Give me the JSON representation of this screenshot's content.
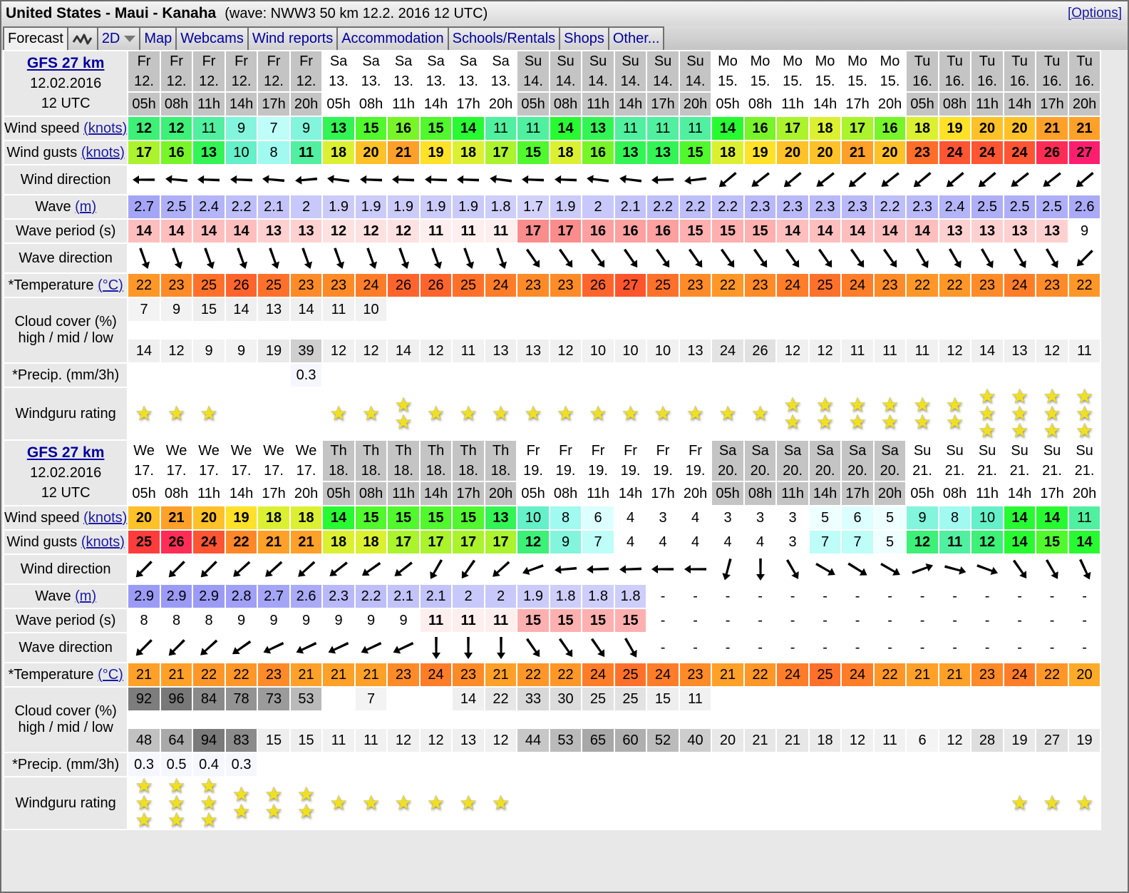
{
  "title": {
    "spot": "United States - Maui - Kanaha",
    "wave_info": "(wave: NWW3 50 km 12.2. 2016 12 UTC)",
    "options_link": "[Options]"
  },
  "tabs": [
    {
      "label": "Forecast",
      "active": true
    },
    {
      "label": "",
      "icon": "waveform-icon"
    },
    {
      "label": "2D",
      "icon": "dropdown-triangle-icon"
    },
    {
      "label": "Map"
    },
    {
      "label": "Webcams"
    },
    {
      "label": "Wind reports"
    },
    {
      "label": "Accommodation"
    },
    {
      "label": "Schools/Rentals"
    },
    {
      "label": "Shops"
    },
    {
      "label": "Other..."
    }
  ],
  "labels": {
    "wind_speed": "Wind speed ",
    "wind_gusts": "Wind gusts ",
    "knots": "(knots)",
    "wind_direction": "Wind direction",
    "wave": "Wave ",
    "wave_unit": "(m)",
    "wave_period": "Wave period (s)",
    "wave_direction": "Wave direction",
    "temperature": "*Temperature ",
    "temp_unit": "(°C)",
    "cloud_cover_1": "Cloud cover (%)",
    "cloud_cover_2": "high / mid / low",
    "precip": "*Precip. (mm/3h)",
    "rating": "Windguru rating"
  },
  "colors": {
    "link": "#1a1aa6",
    "label_bg": "#e8e8e8",
    "day_light": "#ececec",
    "day_dark": "#c4c4c4",
    "star": "#f0e020"
  },
  "blocks": [
    {
      "model": "GFS 27 km",
      "date": "12.02.2016",
      "utc": "12 UTC",
      "days": [
        "Fr",
        "Fr",
        "Fr",
        "Fr",
        "Fr",
        "Fr",
        "Sa",
        "Sa",
        "Sa",
        "Sa",
        "Sa",
        "Sa",
        "Su",
        "Su",
        "Su",
        "Su",
        "Su",
        "Su",
        "Mo",
        "Mo",
        "Mo",
        "Mo",
        "Mo",
        "Mo",
        "Tu",
        "Tu",
        "Tu",
        "Tu",
        "Tu",
        "Tu"
      ],
      "dates": [
        "12.",
        "12.",
        "12.",
        "12.",
        "12.",
        "12.",
        "13.",
        "13.",
        "13.",
        "13.",
        "13.",
        "13.",
        "14.",
        "14.",
        "14.",
        "14.",
        "14.",
        "14.",
        "15.",
        "15.",
        "15.",
        "15.",
        "15.",
        "15.",
        "16.",
        "16.",
        "16.",
        "16.",
        "16.",
        "16."
      ],
      "hours": [
        "05h",
        "08h",
        "11h",
        "14h",
        "17h",
        "20h",
        "05h",
        "08h",
        "11h",
        "14h",
        "17h",
        "20h",
        "05h",
        "08h",
        "11h",
        "14h",
        "17h",
        "20h",
        "05h",
        "08h",
        "11h",
        "14h",
        "17h",
        "20h",
        "05h",
        "08h",
        "11h",
        "14h",
        "17h",
        "20h"
      ],
      "dark_day": [
        true,
        true,
        true,
        true,
        true,
        true,
        false,
        false,
        false,
        false,
        false,
        false,
        true,
        true,
        true,
        true,
        true,
        true,
        false,
        false,
        false,
        false,
        false,
        false,
        true,
        true,
        true,
        true,
        true,
        true
      ],
      "wind_speed": [
        12,
        12,
        11,
        9,
        7,
        9,
        13,
        15,
        16,
        15,
        14,
        11,
        11,
        14,
        13,
        11,
        11,
        11,
        14,
        16,
        17,
        18,
        17,
        16,
        18,
        19,
        20,
        20,
        21,
        21
      ],
      "wind_gusts": [
        17,
        16,
        13,
        10,
        8,
        11,
        18,
        20,
        21,
        19,
        18,
        17,
        15,
        18,
        16,
        13,
        13,
        15,
        18,
        19,
        20,
        20,
        21,
        20,
        23,
        24,
        24,
        24,
        26,
        27
      ],
      "wind_dir_to": [
        270,
        275,
        272,
        272,
        275,
        265,
        277,
        272,
        272,
        272,
        272,
        277,
        272,
        272,
        277,
        277,
        268,
        263,
        230,
        232,
        230,
        232,
        230,
        232,
        230,
        230,
        230,
        232,
        232,
        230
      ],
      "wave": [
        "2.7",
        "2.5",
        "2.4",
        "2.2",
        "2.1",
        "2",
        "1.9",
        "1.9",
        "1.9",
        "1.9",
        "1.9",
        "1.8",
        "1.7",
        "1.9",
        "2",
        "2.1",
        "2.2",
        "2.2",
        "2.2",
        "2.3",
        "2.3",
        "2.3",
        "2.3",
        "2.2",
        "2.3",
        "2.4",
        "2.5",
        "2.5",
        "2.5",
        "2.6"
      ],
      "wave_period": [
        "14",
        "14",
        "14",
        "14",
        "13",
        "13",
        "12",
        "12",
        "12",
        "11",
        "11",
        "11",
        "17",
        "17",
        "16",
        "16",
        "16",
        "15",
        "15",
        "15",
        "14",
        "14",
        "14",
        "14",
        "14",
        "13",
        "13",
        "13",
        "13",
        "9"
      ],
      "wave_dir_to": [
        160,
        160,
        160,
        160,
        160,
        160,
        160,
        160,
        160,
        160,
        160,
        160,
        145,
        145,
        145,
        145,
        145,
        145,
        145,
        145,
        145,
        145,
        145,
        145,
        150,
        150,
        150,
        150,
        150,
        225
      ],
      "temperature": [
        22,
        23,
        25,
        26,
        25,
        23,
        23,
        24,
        26,
        26,
        25,
        24,
        23,
        23,
        26,
        27,
        25,
        23,
        22,
        23,
        24,
        25,
        24,
        23,
        22,
        22,
        23,
        24,
        23,
        22
      ],
      "cloud_high": [
        "7",
        "9",
        "15",
        "14",
        "13",
        "14",
        "11",
        "10",
        "",
        "",
        "",
        "",
        "",
        "",
        "",
        "",
        "",
        "",
        "",
        "",
        "",
        "",
        "",
        "",
        "",
        "",
        "",
        "",
        "",
        ""
      ],
      "cloud_mid": [
        "",
        "",
        "",
        "",
        "",
        "",
        "",
        "",
        "",
        "",
        "",
        "",
        "",
        "",
        "",
        "",
        "",
        "",
        "",
        "",
        "",
        "",
        "",
        "",
        "",
        "",
        "",
        "",
        "",
        ""
      ],
      "cloud_low": [
        "14",
        "12",
        "9",
        "9",
        "19",
        "39",
        "12",
        "12",
        "14",
        "12",
        "11",
        "13",
        "13",
        "12",
        "10",
        "10",
        "10",
        "13",
        "24",
        "26",
        "12",
        "12",
        "11",
        "11",
        "11",
        "12",
        "14",
        "13",
        "12",
        "11"
      ],
      "precip": [
        "",
        "",
        "",
        "",
        "",
        "0.3",
        "",
        "",
        "",
        "",
        "",
        "",
        "",
        "",
        "",
        "",
        "",
        "",
        "",
        "",
        "",
        "",
        "",
        "",
        "",
        "",
        "",
        "",
        "",
        ""
      ],
      "rating": [
        1,
        1,
        1,
        0,
        0,
        0,
        1,
        1,
        2,
        1,
        1,
        1,
        1,
        1,
        1,
        1,
        1,
        1,
        1,
        1,
        2,
        2,
        2,
        2,
        2,
        2,
        3,
        3,
        3,
        3
      ]
    },
    {
      "model": "GFS 27 km",
      "date": "12.02.2016",
      "utc": "12 UTC",
      "days": [
        "We",
        "We",
        "We",
        "We",
        "We",
        "We",
        "Th",
        "Th",
        "Th",
        "Th",
        "Th",
        "Th",
        "Fr",
        "Fr",
        "Fr",
        "Fr",
        "Fr",
        "Fr",
        "Sa",
        "Sa",
        "Sa",
        "Sa",
        "Sa",
        "Sa",
        "Su",
        "Su",
        "Su",
        "Su",
        "Su",
        "Su"
      ],
      "dates": [
        "17.",
        "17.",
        "17.",
        "17.",
        "17.",
        "17.",
        "18.",
        "18.",
        "18.",
        "18.",
        "18.",
        "18.",
        "19.",
        "19.",
        "19.",
        "19.",
        "19.",
        "19.",
        "20.",
        "20.",
        "20.",
        "20.",
        "20.",
        "20.",
        "21.",
        "21.",
        "21.",
        "21.",
        "21.",
        "21."
      ],
      "hours": [
        "05h",
        "08h",
        "11h",
        "14h",
        "17h",
        "20h",
        "05h",
        "08h",
        "11h",
        "14h",
        "17h",
        "20h",
        "05h",
        "08h",
        "11h",
        "14h",
        "17h",
        "20h",
        "05h",
        "08h",
        "11h",
        "14h",
        "17h",
        "20h",
        "05h",
        "08h",
        "11h",
        "14h",
        "17h",
        "20h"
      ],
      "dark_day": [
        false,
        false,
        false,
        false,
        false,
        false,
        true,
        true,
        true,
        true,
        true,
        true,
        false,
        false,
        false,
        false,
        false,
        false,
        true,
        true,
        true,
        true,
        true,
        true,
        false,
        false,
        false,
        false,
        false,
        false
      ],
      "wind_speed": [
        20,
        21,
        20,
        19,
        18,
        18,
        14,
        15,
        15,
        15,
        15,
        13,
        10,
        8,
        6,
        4,
        3,
        4,
        3,
        3,
        3,
        5,
        6,
        5,
        9,
        8,
        10,
        14,
        14,
        11
      ],
      "wind_gusts": [
        25,
        26,
        24,
        22,
        21,
        21,
        18,
        18,
        17,
        17,
        17,
        17,
        12,
        9,
        7,
        4,
        4,
        4,
        4,
        4,
        3,
        7,
        7,
        5,
        12,
        11,
        12,
        14,
        15,
        14
      ],
      "wind_dir_to": [
        225,
        225,
        225,
        228,
        228,
        228,
        232,
        235,
        232,
        210,
        215,
        228,
        250,
        265,
        268,
        268,
        270,
        270,
        195,
        180,
        150,
        120,
        122,
        120,
        70,
        105,
        110,
        145,
        150,
        155
      ],
      "wave": [
        "2.9",
        "2.9",
        "2.9",
        "2.8",
        "2.7",
        "2.6",
        "2.3",
        "2.2",
        "2.1",
        "2.1",
        "2",
        "2",
        "1.9",
        "1.8",
        "1.8",
        "1.8",
        "-",
        "-",
        "-",
        "-",
        "-",
        "-",
        "-",
        "-",
        "-",
        "-",
        "-",
        "-",
        "-",
        "-"
      ],
      "wave_period": [
        "8",
        "8",
        "8",
        "9",
        "9",
        "9",
        "9",
        "9",
        "9",
        "11",
        "11",
        "11",
        "15",
        "15",
        "15",
        "15",
        "-",
        "-",
        "-",
        "-",
        "-",
        "-",
        "-",
        "-",
        "-",
        "-",
        "-",
        "-",
        "-",
        "-"
      ],
      "wave_dir_to": [
        225,
        225,
        228,
        235,
        245,
        245,
        245,
        245,
        245,
        180,
        180,
        180,
        145,
        145,
        145,
        150,
        null,
        null,
        null,
        null,
        null,
        null,
        null,
        null,
        null,
        null,
        null,
        null,
        null,
        null
      ],
      "temperature": [
        21,
        21,
        22,
        22,
        23,
        21,
        21,
        21,
        23,
        24,
        23,
        21,
        22,
        22,
        24,
        25,
        24,
        23,
        21,
        22,
        24,
        25,
        24,
        22,
        21,
        21,
        23,
        24,
        22,
        20
      ],
      "cloud_high": [
        "92",
        "96",
        "84",
        "78",
        "73",
        "53",
        "",
        "7",
        "",
        "",
        "14",
        "22",
        "33",
        "30",
        "25",
        "25",
        "15",
        "11",
        "",
        "",
        "",
        "",
        "",
        "",
        "",
        "",
        "",
        "",
        "",
        ""
      ],
      "cloud_mid": [
        "",
        "",
        "",
        "",
        "",
        "",
        "",
        "",
        "",
        "",
        "",
        "",
        "",
        "",
        "",
        "",
        "",
        "",
        "",
        "",
        "",
        "",
        "",
        "",
        "",
        "",
        "",
        "",
        "",
        ""
      ],
      "cloud_low": [
        "48",
        "64",
        "94",
        "83",
        "15",
        "15",
        "11",
        "11",
        "12",
        "12",
        "13",
        "12",
        "44",
        "53",
        "65",
        "60",
        "52",
        "40",
        "20",
        "21",
        "21",
        "18",
        "12",
        "11",
        "6",
        "12",
        "28",
        "19",
        "27",
        "19"
      ],
      "precip": [
        "0.3",
        "0.5",
        "0.4",
        "0.3",
        "",
        "",
        "",
        "",
        "",
        "",
        "",
        "",
        "",
        "",
        "",
        "",
        "",
        "",
        "",
        "",
        "",
        "",
        "",
        "",
        "",
        "",
        "",
        "",
        "",
        ""
      ],
      "rating": [
        3,
        3,
        3,
        2,
        2,
        2,
        1,
        1,
        1,
        1,
        1,
        1,
        0,
        0,
        0,
        0,
        0,
        0,
        0,
        0,
        0,
        0,
        0,
        0,
        0,
        0,
        0,
        1,
        1,
        1
      ]
    }
  ]
}
